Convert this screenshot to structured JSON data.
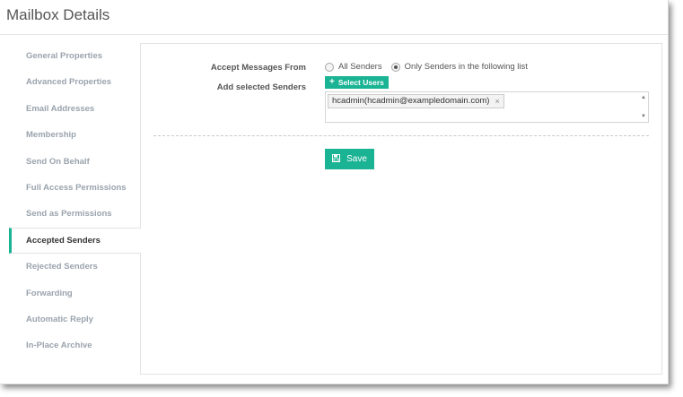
{
  "title": "Mailbox Details",
  "sidebar": {
    "items": [
      {
        "label": "General Properties"
      },
      {
        "label": "Advanced Properties"
      },
      {
        "label": "Email Addresses"
      },
      {
        "label": "Membership"
      },
      {
        "label": "Send On Behalf"
      },
      {
        "label": "Full Access Permissions"
      },
      {
        "label": "Send as Permissions"
      },
      {
        "label": "Accepted Senders",
        "active": true
      },
      {
        "label": "Rejected Senders"
      },
      {
        "label": "Forwarding"
      },
      {
        "label": "Automatic Reply"
      },
      {
        "label": "In-Place Archive"
      }
    ]
  },
  "form": {
    "accept_label": "Accept Messages From",
    "options": [
      "All Senders",
      "Only Senders in the following list"
    ],
    "selected_option": "Only Senders in the following list",
    "add_label": "Add selected Senders",
    "select_users_label": "Select Users",
    "tags": [
      "hcadmin(hcadmin@exampledomain.com)"
    ],
    "tag_remove": "×",
    "save_label": "Save"
  },
  "colors": {
    "accent": "#1ab394",
    "nav_inactive": "#9aa3ad",
    "text": "#555555"
  }
}
